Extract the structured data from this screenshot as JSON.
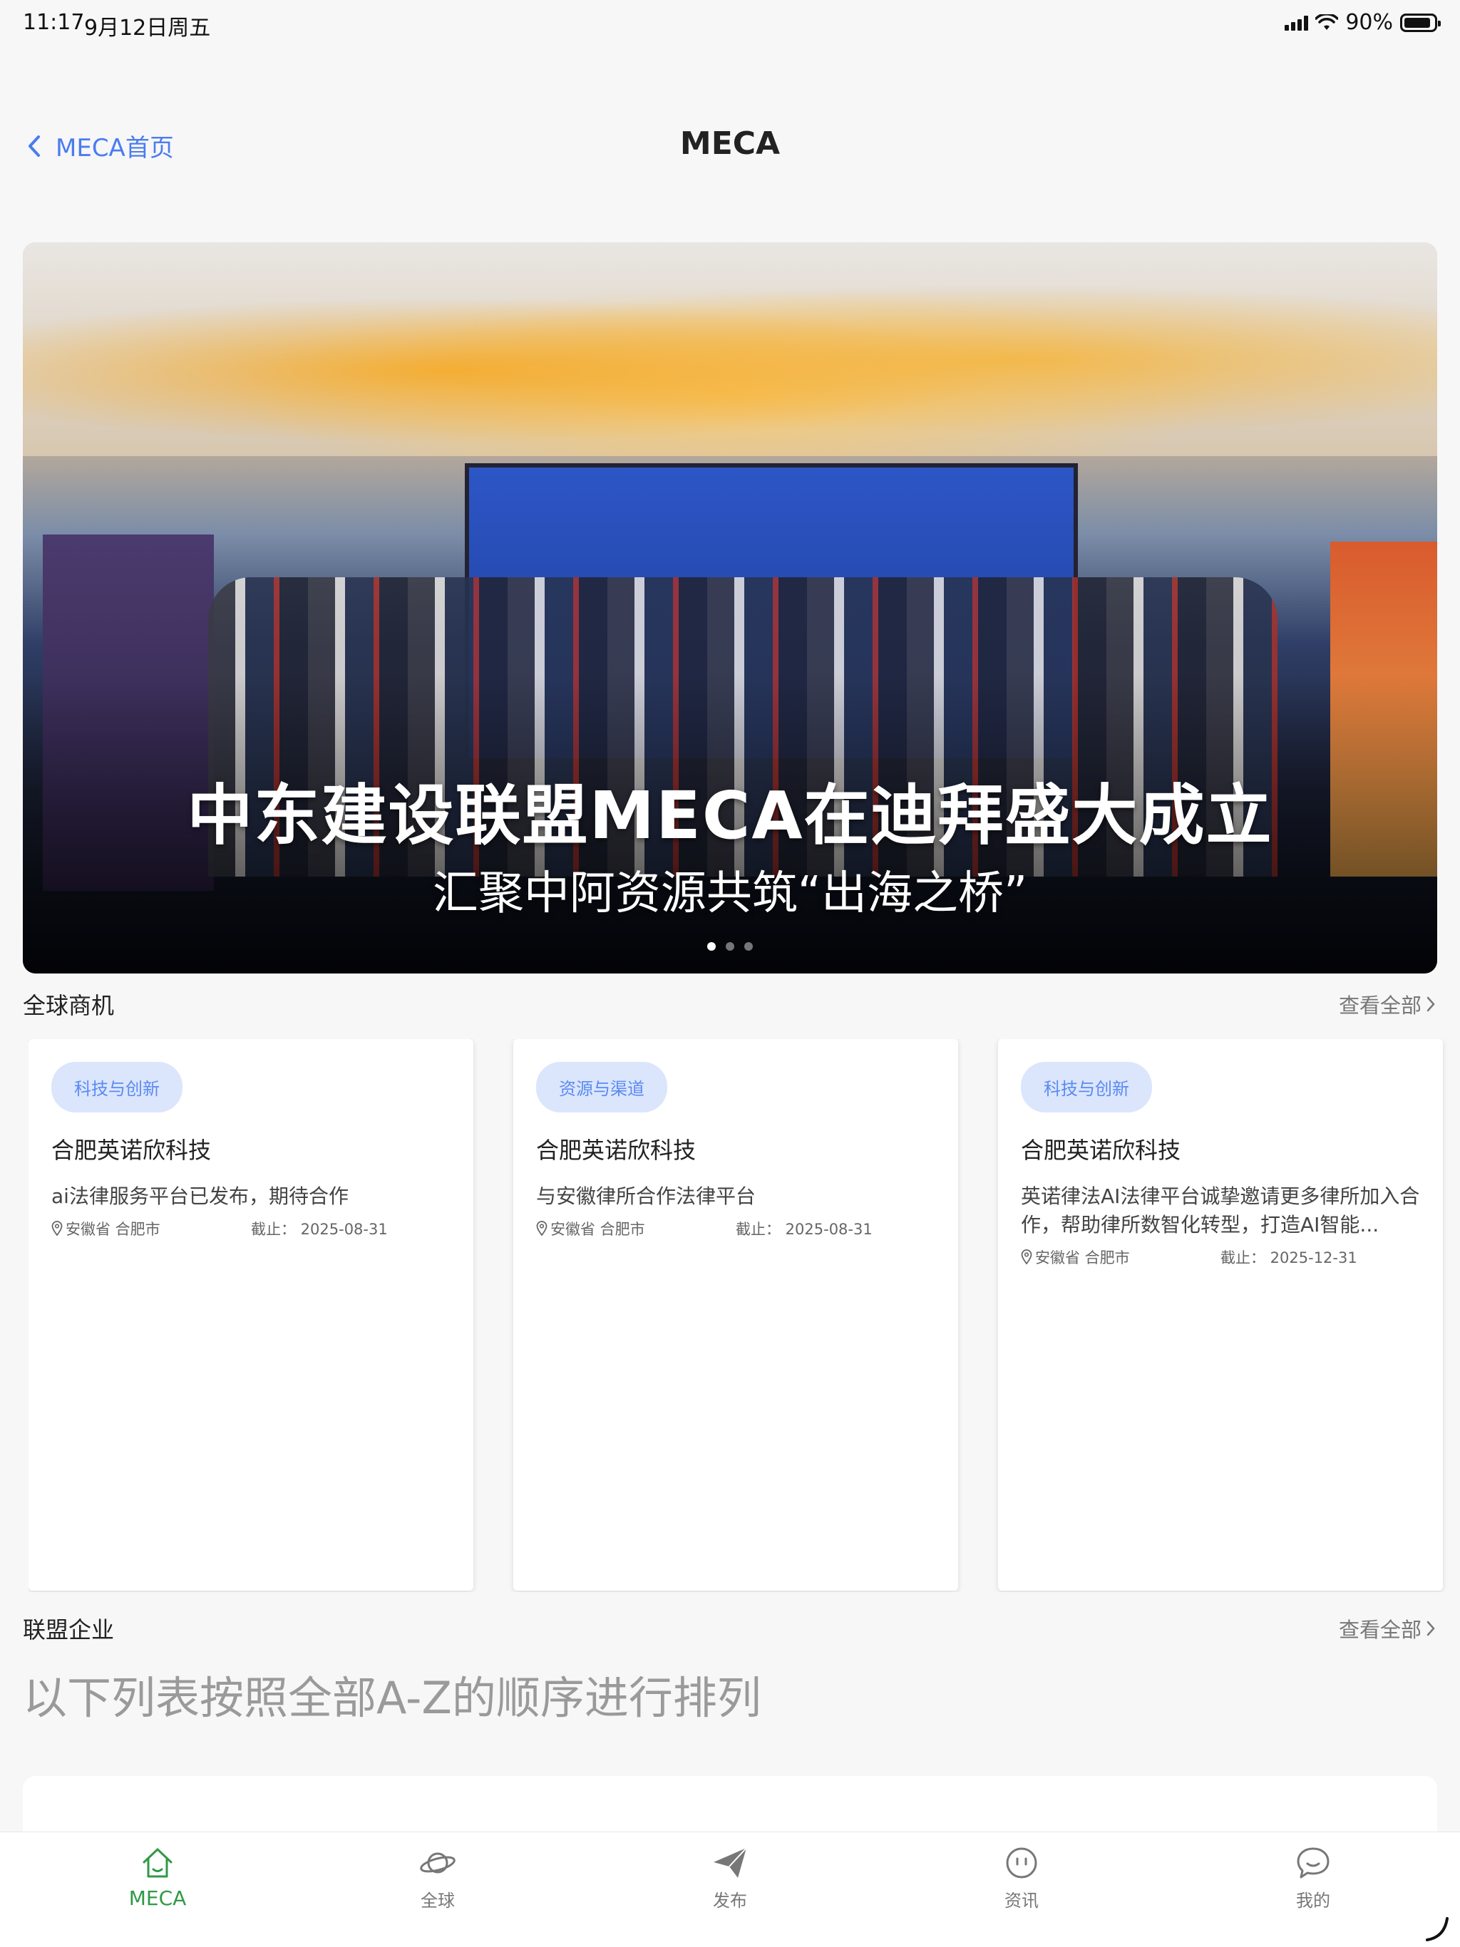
{
  "status_bar": {
    "time": "11:17",
    "date": "9月12日周五",
    "battery": "90%",
    "battery_level": 0.9
  },
  "nav": {
    "back_label": "MECA首页",
    "title": "MECA"
  },
  "banner": {
    "headline": "中东建设联盟MECA在迪拜盛大成立",
    "subtitle": "汇聚中阿资源共筑“出海之桥”",
    "slide_count": 3,
    "active_slide": 1
  },
  "opportunities": {
    "title": "全球商机",
    "see_all": "查看全部",
    "cards": [
      {
        "tag": "科技与创新",
        "title": "合肥英诺欣科技",
        "desc": "ai法律服务平台已发布，期待合作",
        "location": "安徽省 合肥市",
        "deadline": "截止：  2025-08-31"
      },
      {
        "tag": "资源与渠道",
        "title": "合肥英诺欣科技",
        "desc": "与安徽律所合作法律平台",
        "location": "安徽省 合肥市",
        "deadline": "截止：  2025-08-31"
      },
      {
        "tag": "科技与创新",
        "title": "合肥英诺欣科技",
        "desc": "英诺律法AI法律平台诚挚邀请更多律所加入合作，帮助律所数智化转型，打造AI智能...",
        "location": "安徽省 合肥市",
        "deadline": "截止：  2025-12-31"
      }
    ]
  },
  "alliance": {
    "title": "联盟企业",
    "see_all": "查看全部",
    "note": "以下列表按照全部A-Z的顺序进行排列"
  },
  "tabbar": {
    "tabs": [
      {
        "label": "MECA",
        "icon": "home-icon",
        "active": true
      },
      {
        "label": "全球",
        "icon": "planet-icon",
        "active": false
      },
      {
        "label": "发布",
        "icon": "paper-plane-icon",
        "active": false
      },
      {
        "label": "资讯",
        "icon": "news-face-icon",
        "active": false
      },
      {
        "label": "我的",
        "icon": "chat-bubble-icon",
        "active": false
      }
    ]
  },
  "colors": {
    "accent_blue": "#4a7cf0",
    "tag_bg": "#dbe6fd",
    "tag_text": "#5b8af1",
    "tab_active": "#2f9a45"
  }
}
